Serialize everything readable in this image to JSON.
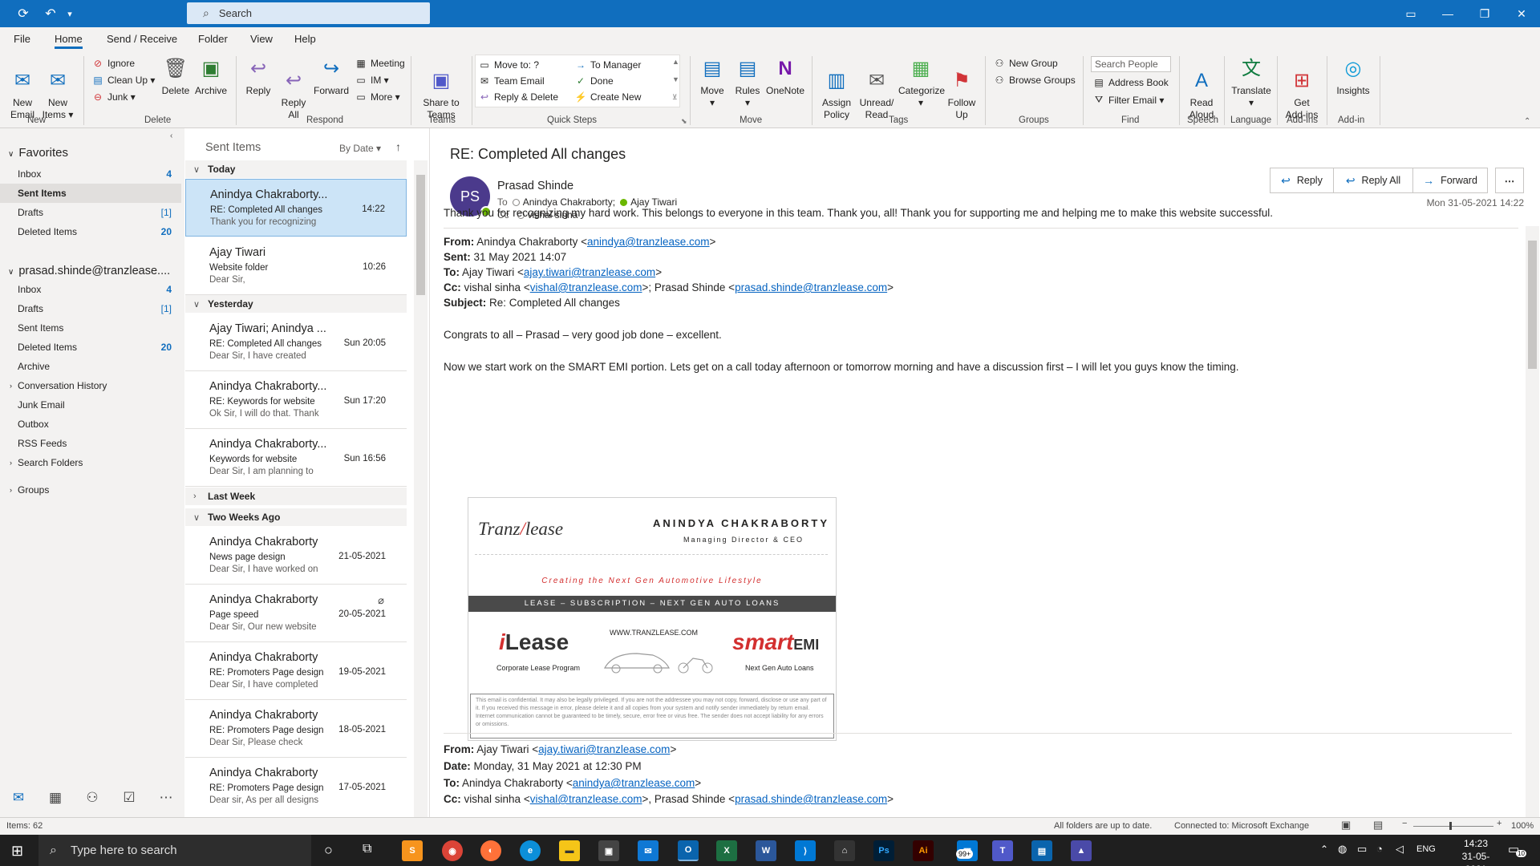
{
  "titlebar": {
    "search_placeholder": "Search"
  },
  "menu": {
    "tabs": [
      "File",
      "Home",
      "Send / Receive",
      "Folder",
      "View",
      "Help"
    ]
  },
  "ribbon": {
    "new_email": "New\nEmail",
    "new_items": "New\nItems",
    "ignore": "Ignore",
    "clean_up": "Clean Up",
    "junk": "Junk",
    "delete": "Delete",
    "archive": "Archive",
    "reply": "Reply",
    "reply_all": "Reply\nAll",
    "forward": "Forward",
    "meeting": "Meeting",
    "im": "IM",
    "more": "More",
    "share_to_teams": "Share to\nTeams",
    "qs_move_to": "Move to: ?",
    "qs_team_email": "Team Email",
    "qs_reply_delete": "Reply & Delete",
    "qs_to_manager": "To Manager",
    "qs_done": "Done",
    "qs_create_new": "Create New",
    "move": "Move",
    "rules": "Rules",
    "onenote": "OneNote",
    "assign_policy": "Assign\nPolicy",
    "unread_read": "Unread/\nRead",
    "categorize": "Categorize",
    "follow_up": "Follow\nUp",
    "new_group": "New Group",
    "browse_groups": "Browse Groups",
    "search_people": "Search People",
    "address_book": "Address Book",
    "filter_email": "Filter Email",
    "read_aloud": "Read\nAloud",
    "translate": "Translate",
    "get_addins": "Get\nAdd-ins",
    "insights": "Insights",
    "groups": [
      "New",
      "Delete",
      "Respond",
      "Teams",
      "Quick Steps",
      "Move",
      "Tags",
      "Groups",
      "Find",
      "Speech",
      "Language",
      "Add-ins",
      "Add-in"
    ]
  },
  "folders": {
    "favorites_label": "Favorites",
    "favorites": [
      {
        "label": "Inbox",
        "count": "4"
      },
      {
        "label": "Sent Items",
        "count": ""
      },
      {
        "label": "Drafts",
        "count": "[1]"
      },
      {
        "label": "Deleted Items",
        "count": "20"
      }
    ],
    "account_label": "prasad.shinde@tranzlease....",
    "account": [
      {
        "label": "Inbox",
        "count": "4"
      },
      {
        "label": "Drafts",
        "count": "[1]"
      },
      {
        "label": "Sent Items",
        "count": ""
      },
      {
        "label": "Deleted Items",
        "count": "20"
      },
      {
        "label": "Archive",
        "count": ""
      },
      {
        "label": "Conversation History",
        "count": ""
      },
      {
        "label": "Junk Email",
        "count": ""
      },
      {
        "label": "Outbox",
        "count": ""
      },
      {
        "label": "RSS Feeds",
        "count": ""
      },
      {
        "label": "Search Folders",
        "count": ""
      }
    ],
    "groups_label": "Groups"
  },
  "list": {
    "folder_title": "Sent Items",
    "sort": "By Date",
    "groups": [
      "Today",
      "Yesterday",
      "Last Week",
      "Two Weeks Ago"
    ],
    "today": [
      {
        "from": "Anindya Chakraborty...",
        "subject": "RE: Completed All changes",
        "preview": "Thank you for recognizing",
        "date": "14:22"
      },
      {
        "from": "Ajay Tiwari",
        "subject": "Website folder",
        "preview": "Dear Sir,",
        "date": "10:26"
      }
    ],
    "yesterday": [
      {
        "from": "Ajay Tiwari; Anindya ...",
        "subject": "RE: Completed All changes",
        "preview": "Dear Sir,   I have created",
        "date": "Sun 20:05"
      },
      {
        "from": "Anindya Chakraborty...",
        "subject": "RE: Keywords for website",
        "preview": "Ok Sir, I will do that. Thank",
        "date": "Sun 17:20"
      },
      {
        "from": "Anindya Chakraborty...",
        "subject": "Keywords for website",
        "preview": "Dear Sir,   I am planning to",
        "date": "Sun 16:56"
      }
    ],
    "two_weeks": [
      {
        "from": "Anindya Chakraborty",
        "subject": "News page design",
        "preview": "Dear Sir,   I have worked on",
        "date": "21-05-2021"
      },
      {
        "from": "Anindya Chakraborty",
        "subject": "Page speed",
        "preview": "Dear Sir,   Our new website",
        "date": "20-05-2021"
      },
      {
        "from": "Anindya Chakraborty",
        "subject": "RE: Promoters Page design",
        "preview": "Dear Sir,   I have completed",
        "date": "19-05-2021"
      },
      {
        "from": "Anindya Chakraborty",
        "subject": "RE: Promoters Page design",
        "preview": "Dear Sir,   Please check",
        "date": "18-05-2021"
      },
      {
        "from": "Anindya Chakraborty",
        "subject": "RE: Promoters Page design",
        "preview": "Dear sir,   As per all designs",
        "date": "17-05-2021"
      }
    ]
  },
  "reading": {
    "subject": "RE: Completed All changes",
    "avatar_initials": "PS",
    "sender": "Prasad Shinde",
    "to_label": "To",
    "to_1": "Anindya Chakraborty;",
    "to_2": "Ajay Tiwari",
    "cc_label": "Cc",
    "cc_1": "vishal sinha",
    "datetime": "Mon 31-05-2021 14:22",
    "btn_reply": "Reply",
    "btn_reply_all": "Reply All",
    "btn_forward": "Forward",
    "line1": "Thank you for recognizing my hard work. This belongs to everyone in this team. Thank you, all! Thank you for supporting me and helping me to make this website successful.",
    "q1_from_label": "From:",
    "q1_from": "Anindya Chakraborty <",
    "q1_from_link": "anindya@tranzlease.com",
    "q1_sent_label": "Sent:",
    "q1_sent": "31 May 2021 14:07",
    "q1_to_label": "To:",
    "q1_to": "Ajay Tiwari <",
    "q1_to_link": "ajay.tiwari@tranzlease.com",
    "q1_cc_label": "Cc:",
    "q1_cc": "vishal sinha <",
    "q1_cc_link1": "vishal@tranzlease.com",
    "q1_cc_mid": ">; Prasad Shinde <",
    "q1_cc_link2": "prasad.shinde@tranzlease.com",
    "q1_subject_label": "Subject:",
    "q1_subject": "Re: Completed All changes",
    "congrats": "Congrats to all – Prasad – very good job done – excellent.",
    "smart": "Now we start work on the SMART EMI portion. Lets get on a call today afternoon or tomorrow morning and have a discussion first – I will let you guys know the timing.",
    "sig_logo_1": "Tranz",
    "sig_logo_2": "lease",
    "sig_name": "ANINDYA CHAKRABORTY",
    "sig_title": "Managing Director & CEO",
    "sig_tagline": "Creating the Next Gen Automotive Lifestyle",
    "sig_band": "LEASE – SUBSCRIPTION – NEXT GEN AUTO LOANS",
    "sig_ilease_i": "i",
    "sig_ilease": "Lease",
    "sig_ilease_sub": "Corporate Lease Program",
    "sig_www": "WWW.TRANZLEASE.COM",
    "sig_smart": "smart",
    "sig_emi": "EMI",
    "sig_smart_sub": "Next Gen Auto Loans",
    "sig_disclaimer": "This email is confidential. It may also be legally privileged. If you are not the addressee you may not copy, forward, disclose or use any part of it. If you received this message in error, please delete it and all copies from your system and notify sender immediately by return email. Internet communication cannot be guaranteed to be timely, secure, error free or virus free. The sender does not accept liability for any errors or omissions.",
    "q2_from_label": "From:",
    "q2_from": "Ajay Tiwari <",
    "q2_from_link": "ajay.tiwari@tranzlease.com",
    "q2_date_label": "Date:",
    "q2_date": "Monday, 31 May 2021 at 12:30 PM",
    "q2_to_label": "To:",
    "q2_to": "Anindya Chakraborty <",
    "q2_to_link": "anindya@tranzlease.com",
    "q2_cc_label": "Cc:",
    "q2_cc": "vishal sinha <",
    "q2_cc_link1": "vishal@tranzlease.com",
    "q2_cc_mid": ">, Prasad Shinde <",
    "q2_cc_link2": "prasad.shinde@tranzlease.com"
  },
  "status": {
    "items": "Items: 62",
    "uptodate": "All folders are up to date.",
    "connected": "Connected to: Microsoft Exchange",
    "zoom": "100%"
  },
  "taskbar": {
    "search_placeholder": "Type here to search",
    "time": "14:23",
    "date": "31-05-2021",
    "lang": "ENG",
    "badge": "99+",
    "notif": "10"
  },
  "colors": {
    "accent": "#106ebe",
    "selected_row": "#cce4f7",
    "link": "#0563c1",
    "brand_red": "#d32f2f",
    "avatar": "#4b3a8c"
  }
}
